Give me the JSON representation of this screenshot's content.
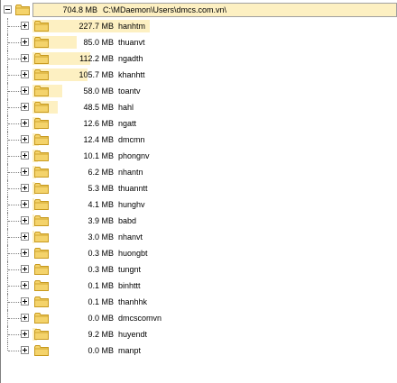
{
  "root": {
    "size": "704.8 MB",
    "path": "C:\\MDaemon\\Users\\dmcs.com.vn\\",
    "fill": 1.0
  },
  "items": [
    {
      "size": "227.7 MB",
      "name": "hanhtm",
      "fill": 0.323
    },
    {
      "size": "85.0 MB",
      "name": "thuanvt",
      "fill": 0.121
    },
    {
      "size": "112.2 MB",
      "name": "ngadth",
      "fill": 0.159
    },
    {
      "size": "105.7 MB",
      "name": "khanhtt",
      "fill": 0.15
    },
    {
      "size": "58.0 MB",
      "name": "toantv",
      "fill": 0.082
    },
    {
      "size": "48.5 MB",
      "name": "hahl",
      "fill": 0.069
    },
    {
      "size": "12.6 MB",
      "name": "ngatt",
      "fill": 0.018
    },
    {
      "size": "12.4 MB",
      "name": "dmcmn",
      "fill": 0.018
    },
    {
      "size": "10.1 MB",
      "name": "phongnv",
      "fill": 0.014
    },
    {
      "size": "6.2 MB",
      "name": "nhantn",
      "fill": 0.009
    },
    {
      "size": "5.3 MB",
      "name": "thuanntt",
      "fill": 0.008
    },
    {
      "size": "4.1 MB",
      "name": "hunghv",
      "fill": 0.006
    },
    {
      "size": "3.9 MB",
      "name": "babd",
      "fill": 0.006
    },
    {
      "size": "3.0 MB",
      "name": "nhanvt",
      "fill": 0.004
    },
    {
      "size": "0.3 MB",
      "name": "huongbt",
      "fill": 0.0004
    },
    {
      "size": "0.3 MB",
      "name": "tungnt",
      "fill": 0.0004
    },
    {
      "size": "0.1 MB",
      "name": "binhttt",
      "fill": 0.0001
    },
    {
      "size": "0.1 MB",
      "name": "thanhhk",
      "fill": 0.0001
    },
    {
      "size": "0.0 MB",
      "name": "dmcscomvn",
      "fill": 0.0
    },
    {
      "size": "9.2 MB",
      "name": "huyendt",
      "fill": 0.013
    },
    {
      "size": "0.0 MB",
      "name": "manpt",
      "fill": 0.0
    }
  ],
  "colors": {
    "bar": "#fdf0c2",
    "folder": "#f4d36b",
    "folder_dark": "#c89a1e"
  },
  "icons": {
    "expand": "plus-box-icon",
    "collapse": "minus-box-icon",
    "folder": "folder-icon"
  }
}
